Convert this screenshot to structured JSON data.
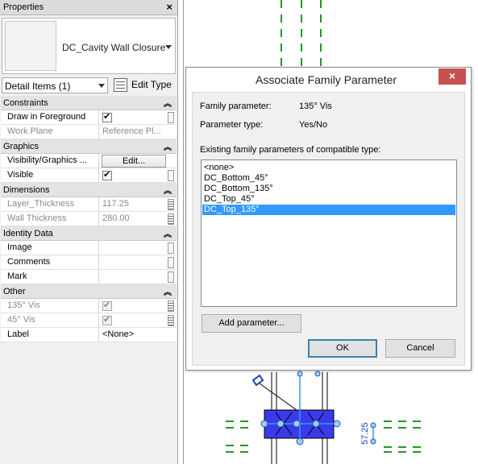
{
  "properties": {
    "title": "Properties",
    "close": "×",
    "type_name": "DC_Cavity Wall Closure",
    "instance_selector": "Detail Items (1)",
    "edit_type": "Edit Type",
    "sections": [
      {
        "name": "Constraints",
        "rows": [
          {
            "label": "Draw in Foreground",
            "kind": "checkbox",
            "checked": true,
            "disabled": false
          },
          {
            "label": "Work Plane",
            "value": "Reference Pl...",
            "disabled": true
          }
        ]
      },
      {
        "name": "Graphics",
        "rows": [
          {
            "label": "Visibility/Graphics ...",
            "kind": "button",
            "value": "Edit..."
          },
          {
            "label": "Visible",
            "kind": "checkbox",
            "checked": true,
            "disabled": false
          }
        ]
      },
      {
        "name": "Dimensions",
        "rows": [
          {
            "label": "Layer_Thickness",
            "value": "117.25",
            "disabled": true
          },
          {
            "label": "Wall Thickness",
            "value": "280.00",
            "disabled": true
          }
        ]
      },
      {
        "name": "Identity Data",
        "rows": [
          {
            "label": "Image",
            "value": ""
          },
          {
            "label": "Comments",
            "value": ""
          },
          {
            "label": "Mark",
            "value": ""
          }
        ]
      },
      {
        "name": "Other",
        "rows": [
          {
            "label": "135° Vis",
            "kind": "checkbox",
            "checked": true,
            "disabled": true
          },
          {
            "label": "45° Vis",
            "kind": "checkbox",
            "checked": true,
            "disabled": true
          },
          {
            "label": "Label",
            "value": "<None>"
          }
        ]
      }
    ]
  },
  "dialog": {
    "title": "Associate Family Parameter",
    "close": "×",
    "family_parameter_label": "Family parameter:",
    "family_parameter_value": "135° Vis",
    "parameter_type_label": "Parameter type:",
    "parameter_type_value": "Yes/No",
    "list_caption": "Existing family parameters of compatible type:",
    "list_items": [
      "<none>",
      "DC_Bottom_45°",
      "DC_Bottom_135°",
      "DC_Top_45°",
      "DC_Top_135°"
    ],
    "selected_index": 4,
    "add_parameter": "Add parameter...",
    "ok": "OK",
    "cancel": "Cancel"
  },
  "canvas": {
    "dimension_text": "57.25",
    "accent_colors": {
      "detail_fill": "#3a3ae8",
      "reference_lines": "#1f9a1f",
      "selection": "#3399ff"
    }
  }
}
